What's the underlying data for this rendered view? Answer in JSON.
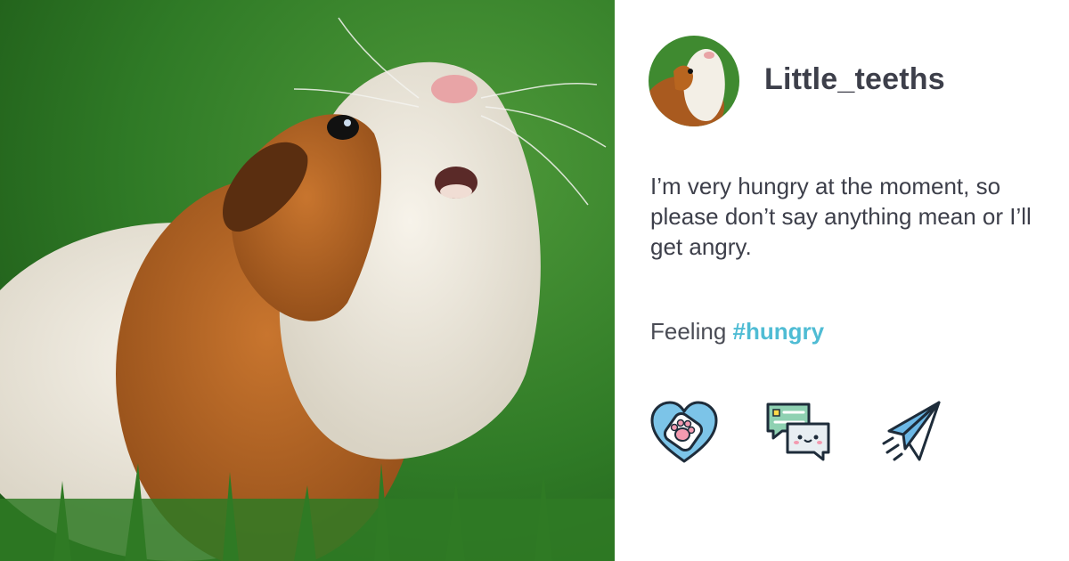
{
  "post": {
    "username": "Little_teeths",
    "text": "I’m very hungry at the moment, so please don’t say anything mean or I’ll get angry.",
    "feeling_prefix": "Feeling",
    "feeling_tag": "#hungry"
  },
  "photo": {
    "subject": "guinea pig"
  },
  "actions": [
    {
      "icon": "heart-paw-icon",
      "label": "like"
    },
    {
      "icon": "chat-bubbles-icon",
      "label": "comment"
    },
    {
      "icon": "paper-plane-icon",
      "label": "share"
    }
  ],
  "colors": {
    "text": "#3d3f4a",
    "hashtag": "#4fbcd4",
    "heart": "#7cc4e8",
    "paw": "#f39ab0",
    "chat_green": "#8fd1b2",
    "plane": "#6cb8e6"
  }
}
